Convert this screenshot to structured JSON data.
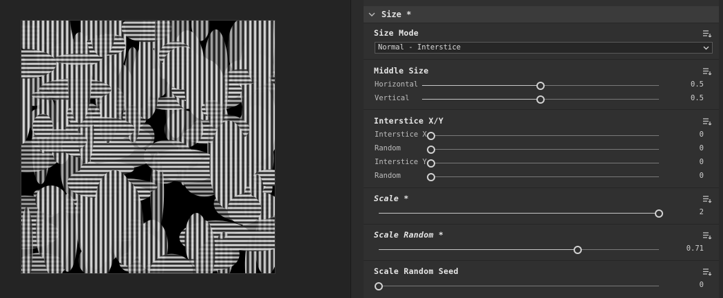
{
  "section": {
    "title": "Size *"
  },
  "size_mode": {
    "title": "Size Mode",
    "dropdown_value": "Normal - Interstice"
  },
  "middle_size": {
    "title": "Middle Size",
    "rows": [
      {
        "label": "Horizontal",
        "value": "0.5",
        "level": 0.5
      },
      {
        "label": "Vertical",
        "value": "0.5",
        "level": 0.5
      }
    ]
  },
  "interstice": {
    "title": "Interstice X/Y",
    "rows": [
      {
        "label": "Interstice X",
        "value": "0",
        "level": 0
      },
      {
        "label": "Random",
        "value": "0",
        "level": 0
      },
      {
        "label": "Interstice Y",
        "value": "0",
        "level": 0
      },
      {
        "label": "Random",
        "value": "0",
        "level": 0
      }
    ]
  },
  "scale": {
    "title": "Scale *",
    "value": "2",
    "level": 1.0
  },
  "scale_random": {
    "title": "Scale Random *",
    "value": "0.71",
    "level": 0.71
  },
  "scale_random_seed": {
    "title": "Scale Random Seed",
    "value": "0",
    "level": 0
  },
  "icons": {
    "collapse": "chevron-down-icon",
    "group_menu": "list-menu-icon",
    "dropdown": "chevron-down-icon"
  }
}
